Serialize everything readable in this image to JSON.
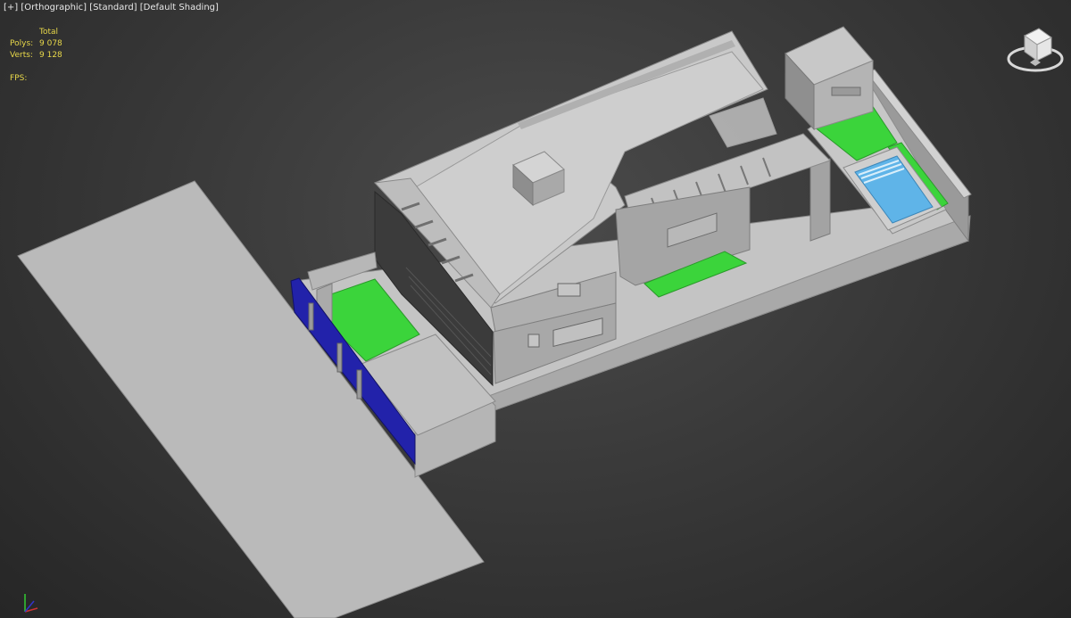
{
  "viewport": {
    "label_plus": "[+]",
    "label_view": "[Orthographic]",
    "label_mode": "[Standard]",
    "label_shading": "[Default Shading]"
  },
  "stats": {
    "header": "Total",
    "polys_label": "Polys:",
    "polys_value": "9 078",
    "verts_label": "Verts:",
    "verts_value": "9 128",
    "fps_label": "FPS:"
  },
  "colors": {
    "model_gray": "#bdbdbd",
    "lawn": "#3bd43b",
    "pool": "#5fb4e8",
    "gate": "#2222aa",
    "stats_text": "#e8d84a"
  },
  "icons": {
    "viewcube": "viewcube-icon",
    "axis": "axis-gizmo-icon"
  }
}
